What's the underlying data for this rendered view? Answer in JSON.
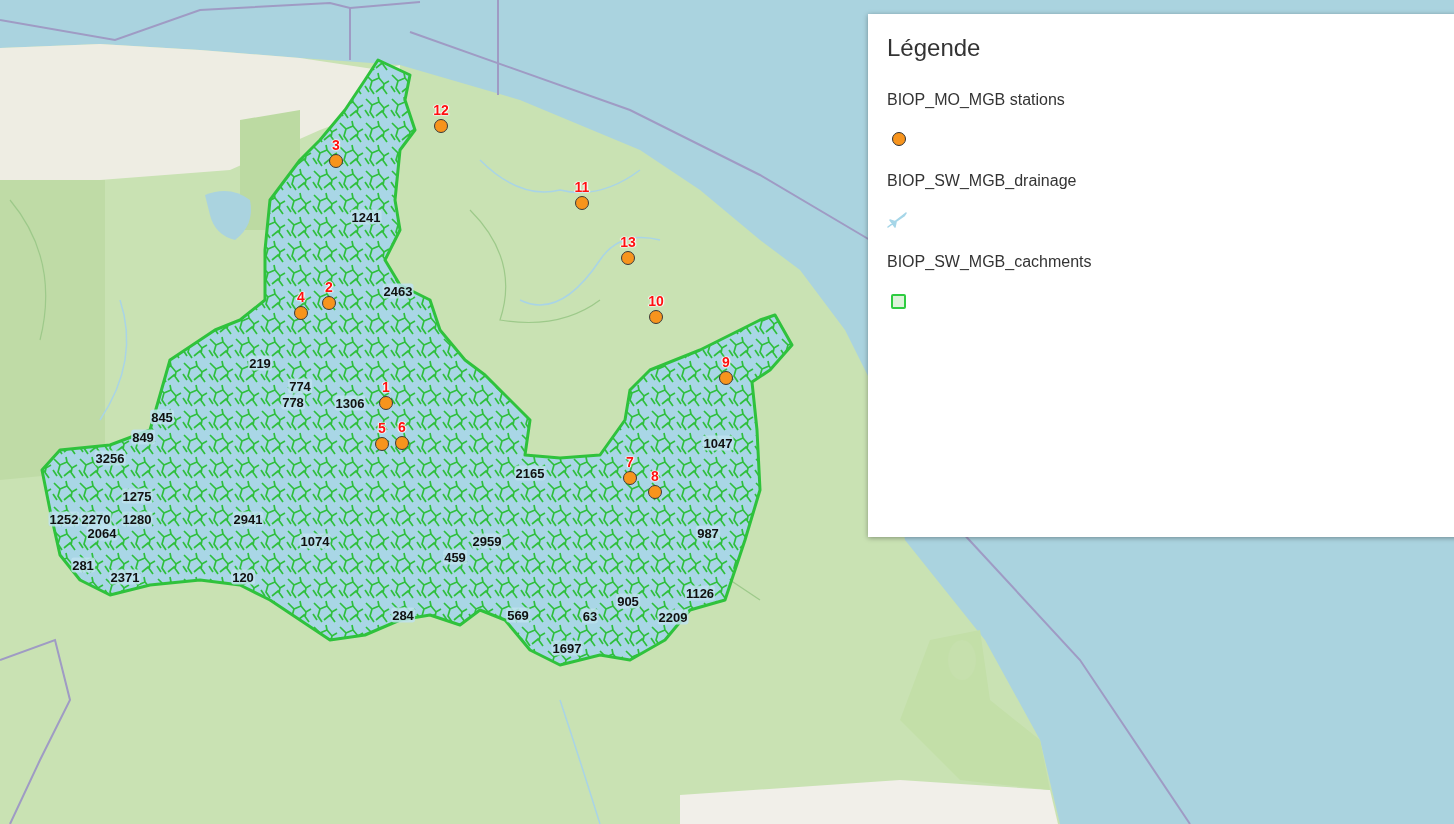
{
  "map": {
    "stations": [
      {
        "label": "1"
      },
      {
        "label": "2"
      },
      {
        "label": "3"
      },
      {
        "label": "4"
      },
      {
        "label": "5"
      },
      {
        "label": "6"
      },
      {
        "label": "7"
      },
      {
        "label": "8"
      },
      {
        "label": "9"
      },
      {
        "label": "10"
      },
      {
        "label": "11"
      },
      {
        "label": "12"
      },
      {
        "label": "13"
      }
    ],
    "catchment_labels": [
      "1241",
      "2463",
      "219",
      "774",
      "778",
      "1306",
      "845",
      "849",
      "1047",
      "3256",
      "2165",
      "1275",
      "1252",
      "2270",
      "1280",
      "2941",
      "2064",
      "987",
      "1074",
      "2959",
      "459",
      "281",
      "2371",
      "120",
      "1126",
      "905",
      "284",
      "569",
      "63",
      "2209",
      "1697"
    ]
  },
  "legend": {
    "title": "Légende",
    "items": [
      {
        "label": "BIOP_MO_MGB stations",
        "kind": "point"
      },
      {
        "label": "BIOP_SW_MGB_drainage",
        "kind": "line"
      },
      {
        "label": "BIOP_SW_MGB_cachments",
        "kind": "polygon"
      }
    ]
  }
}
